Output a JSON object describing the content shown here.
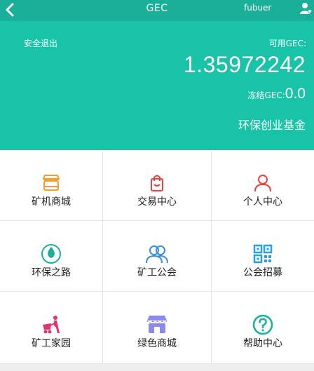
{
  "navbar": {
    "title": "GEC",
    "username": "fubuer",
    "back_icon": "chevron-left-icon",
    "user_icon": "user-icon"
  },
  "account": {
    "logout_label": "安全退出",
    "available_label": "可用GEC:",
    "available_value": "1.35972242",
    "frozen_label": "冻结GEC:",
    "frozen_value": "0.0",
    "fund_label": "环保创业基金"
  },
  "menu": [
    {
      "label": "矿机商城",
      "icon": "shop-icon",
      "color": "#f0a030"
    },
    {
      "label": "交易中心",
      "icon": "shopping-bag-icon",
      "color": "#e8423a"
    },
    {
      "label": "个人中心",
      "icon": "person-icon",
      "color": "#e8423a"
    },
    {
      "label": "环保之路",
      "icon": "leaf-icon",
      "color": "#1aaf98"
    },
    {
      "label": "矿工公会",
      "icon": "group-icon",
      "color": "#3a8fd8"
    },
    {
      "label": "公会招募",
      "icon": "qr-code-icon",
      "color": "#2a9fe0"
    },
    {
      "label": "矿工家园",
      "icon": "miner-cart-icon",
      "color": "#e2336e"
    },
    {
      "label": "绿色商城",
      "icon": "storefront-icon",
      "color": "#8a8af0"
    },
    {
      "label": "帮助中心",
      "icon": "help-icon",
      "color": "#1aaf98"
    }
  ],
  "colors": {
    "navbar": "#1aaf98",
    "hero": "#19c3a8"
  }
}
